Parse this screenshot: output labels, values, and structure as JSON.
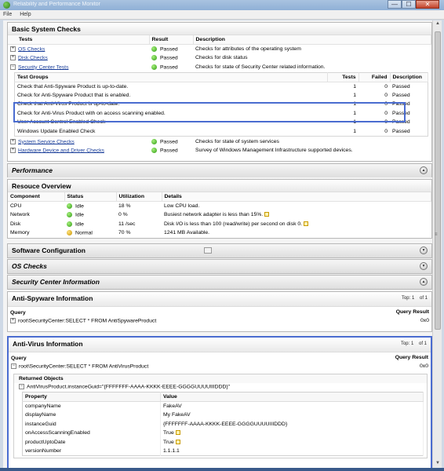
{
  "window": {
    "title": "Reliability and Performance Monitor",
    "controls": {
      "minimize": "—",
      "maximize": "☐",
      "close": "✕"
    }
  },
  "menu": {
    "items": [
      "File",
      "Help"
    ]
  },
  "basic_checks": {
    "title": "Basic System Checks",
    "columns": [
      "Tests",
      "Result",
      "Description"
    ],
    "rows": [
      {
        "test": "OS Checks",
        "result": "Passed",
        "description": "Checks for attributes of the operating system",
        "expander": "+"
      },
      {
        "test": "Disk Checks",
        "result": "Passed",
        "description": "Checks for disk status",
        "expander": "+"
      },
      {
        "test": "Security Center Tests",
        "result": "Passed",
        "description": "Checks for state of Security Center related information.",
        "expander": "−"
      }
    ],
    "sub_columns": [
      "Test Groups",
      "Tests",
      "Failed",
      "Description"
    ],
    "sub_rows": [
      {
        "group": "Check that Anti-Spyware Product is up-to-date.",
        "tests": "1",
        "failed": "0",
        "description": "Passed"
      },
      {
        "group": "Check for Anti-Spyware Product that is enabled.",
        "tests": "1",
        "failed": "0",
        "description": "Passed"
      },
      {
        "group": "Check that Anti-Virus Product is up-to-date.",
        "tests": "1",
        "failed": "0",
        "description": "Passed"
      },
      {
        "group": "Check for Anti-Virus Product with on access scanning enabled.",
        "tests": "1",
        "failed": "0",
        "description": "Passed"
      },
      {
        "group": "User Account Control Enabled Check",
        "tests": "1",
        "failed": "0",
        "description": "Passed"
      },
      {
        "group": "Windows Update Enabled Check",
        "tests": "1",
        "failed": "0",
        "description": "Passed"
      }
    ],
    "rows_after": [
      {
        "test": "System Service Checks",
        "result": "Passed",
        "description": "Checks for state of system services",
        "expander": "+"
      },
      {
        "test": "Hardware Device and Driver Checks",
        "result": "Passed",
        "description": "Survey of Windows Management Infrastructure supported devices.",
        "expander": "+"
      }
    ]
  },
  "performance": {
    "title": "Performance",
    "toggle": "▲"
  },
  "resource_overview": {
    "title": "Resouce Overview",
    "columns": [
      "Component",
      "Status",
      "Utilization",
      "Details"
    ],
    "rows": [
      {
        "component": "CPU",
        "status": "Idle",
        "utilization": "18 %",
        "details": "Low CPU load.",
        "edit": false,
        "status_color": "#2e9a12"
      },
      {
        "component": "Network",
        "status": "Idle",
        "utilization": "0 %",
        "details": "Busiest network adapter is less than 15%.",
        "edit": true,
        "status_color": "#2e9a12"
      },
      {
        "component": "Disk",
        "status": "Idle",
        "utilization": "11 /sec",
        "details": "Disk I/O is less than 100 (read/write) per second on disk 0.",
        "edit": true,
        "status_color": "#2e9a12"
      },
      {
        "component": "Memory",
        "status": "Normal",
        "utilization": "70 %",
        "details": "1241 MB Available.",
        "edit": false,
        "status_color": "#c79200"
      }
    ]
  },
  "collapsed_sections": [
    {
      "title": "Software Configuration",
      "toggle": "▼"
    },
    {
      "title": "OS Checks",
      "toggle": "▼"
    },
    {
      "title": "Security Center Information",
      "toggle": "▲"
    }
  ],
  "anti_spyware": {
    "title": "Anti-Spyware Information",
    "top_label": "Top: 1",
    "of_label": "of 1",
    "query_label": "Query",
    "result_label": "Query Result",
    "query": "root\\SecurityCenter:SELECT * FROM AntiSpywareProduct",
    "result": "0x0"
  },
  "anti_virus": {
    "title": "Anti-Virus Information",
    "top_label": "Top: 1",
    "of_label": "of 1",
    "query_label": "Query",
    "result_label": "Query Result",
    "query": "root\\SecurityCenter:SELECT * FROM AntiVirusProduct",
    "result": "0x0",
    "returned_label": "Returned Objects",
    "instance": "AntiVirusProduct.instanceGuid=\"{FFFFFFF-AAAA-KKKK-EEEE-GGGGUUUUIIIDDD}\"",
    "prop_columns": [
      "Property",
      "Value"
    ],
    "properties": [
      {
        "name": "companyName",
        "value": "FakeAV",
        "edit": false
      },
      {
        "name": "displayName",
        "value": "My FakeAV",
        "edit": false
      },
      {
        "name": "instanceGuid",
        "value": "{FFFFFFF-AAAA-KKKK-EEEE-GGGGUUUUIIIDDD}",
        "edit": false
      },
      {
        "name": "onAccessScanningEnabled",
        "value": "True",
        "edit": true
      },
      {
        "name": "productUptoDate",
        "value": "True",
        "edit": true
      },
      {
        "name": "versionNumber",
        "value": "1.1.1.1",
        "edit": false
      }
    ]
  },
  "colors": {
    "accent_highlight": "#4a6cd0",
    "passed": "#2e9a12",
    "warning": "#c79200"
  }
}
